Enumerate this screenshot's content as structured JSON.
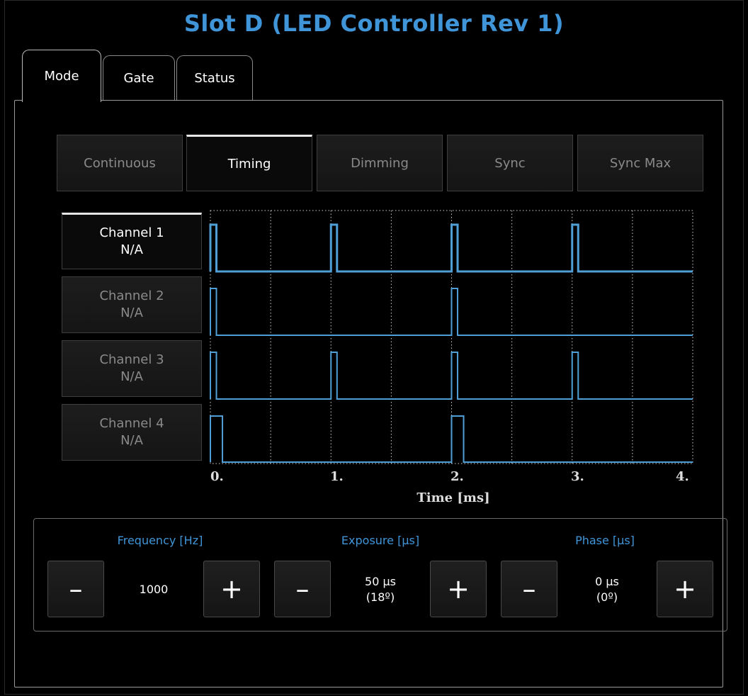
{
  "title": "Slot D (LED Controller Rev 1)",
  "tabs": [
    {
      "label": "Mode",
      "active": true
    },
    {
      "label": "Gate",
      "active": false
    },
    {
      "label": "Status",
      "active": false
    }
  ],
  "modes": [
    {
      "label": "Continuous",
      "active": false
    },
    {
      "label": "Timing",
      "active": true
    },
    {
      "label": "Dimming",
      "active": false
    },
    {
      "label": "Sync",
      "active": false
    },
    {
      "label": "Sync Max",
      "active": false
    }
  ],
  "channels": [
    {
      "name": "Channel 1",
      "value": "N/A",
      "active": true
    },
    {
      "name": "Channel 2",
      "value": "N/A",
      "active": false
    },
    {
      "name": "Channel 3",
      "value": "N/A",
      "active": false
    },
    {
      "name": "Channel 4",
      "value": "N/A",
      "active": false
    }
  ],
  "chart_data": {
    "type": "line",
    "xlabel": "Time [ms]",
    "xlim": [
      0,
      4
    ],
    "x_ticks": [
      "0.",
      "1.",
      "2.",
      "3.",
      "4."
    ],
    "grid": true,
    "series": [
      {
        "name": "Channel 1",
        "pulse_starts_ms": [
          0,
          1,
          2,
          3
        ],
        "pulse_width_ms": 0.05
      },
      {
        "name": "Channel 2",
        "pulse_starts_ms": [
          0,
          2
        ],
        "pulse_width_ms": 0.05
      },
      {
        "name": "Channel 3",
        "pulse_starts_ms": [
          0,
          1,
          2,
          3
        ],
        "pulse_width_ms": 0.05
      },
      {
        "name": "Channel 4",
        "pulse_starts_ms": [
          0,
          2
        ],
        "pulse_width_ms": 0.1
      }
    ],
    "line_color": "#4f9fd6"
  },
  "controls": {
    "frequency": {
      "label": "Frequency [Hz]",
      "value": "1000",
      "value2": ""
    },
    "exposure": {
      "label": "Exposure [µs]",
      "value": "50 µs",
      "value2": "(18º)"
    },
    "phase": {
      "label": "Phase [µs]",
      "value": "0 µs",
      "value2": "(0º)"
    },
    "minus_label": "–",
    "plus_label": "+"
  },
  "colors": {
    "accent": "#3f95d8",
    "background": "#000000"
  }
}
